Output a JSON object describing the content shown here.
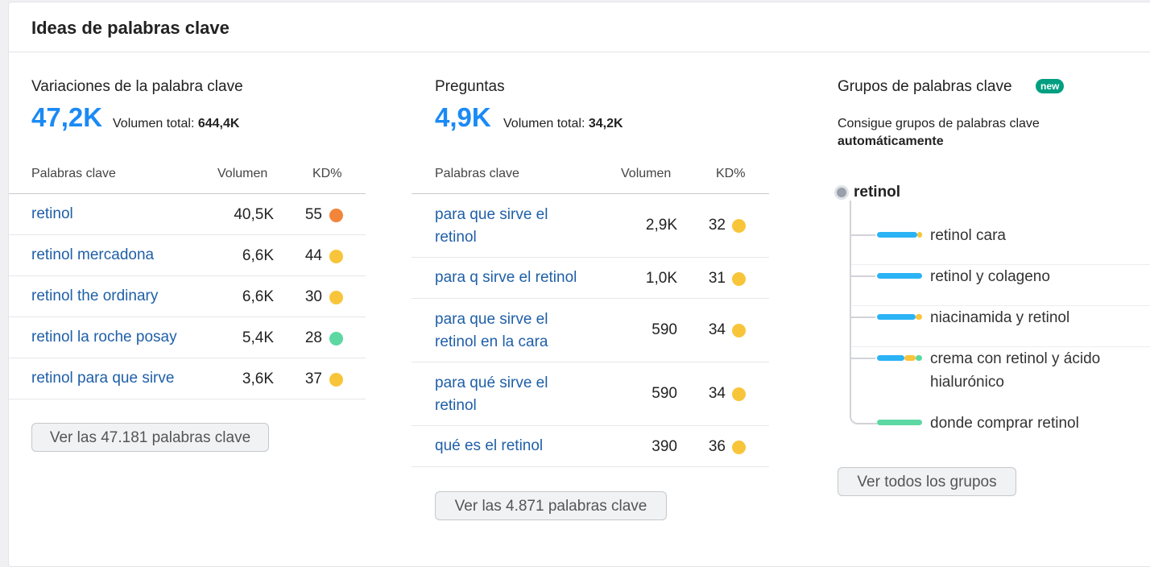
{
  "title": "Ideas de palabras clave",
  "variations": {
    "title": "Variaciones de la palabra clave",
    "count": "47,2K",
    "total_label": "Volumen total:",
    "total_value": "644,4K",
    "headers": {
      "keyword": "Palabras clave",
      "volume": "Volumen",
      "kd": "KD%"
    },
    "rows": [
      {
        "keyword": "retinol",
        "volume": "40,5K",
        "kd": "55",
        "kd_color": "#f2853a"
      },
      {
        "keyword": "retinol mercadona",
        "volume": "6,6K",
        "kd": "44",
        "kd_color": "#f8c53a"
      },
      {
        "keyword": "retinol the ordinary",
        "volume": "6,6K",
        "kd": "30",
        "kd_color": "#f8c53a"
      },
      {
        "keyword": "retinol la roche posay",
        "volume": "5,4K",
        "kd": "28",
        "kd_color": "#5dd8a2"
      },
      {
        "keyword": "retinol para que sirve",
        "volume": "3,6K",
        "kd": "37",
        "kd_color": "#f8c53a"
      }
    ],
    "button": "Ver las 47.181 palabras clave"
  },
  "questions": {
    "title": "Preguntas",
    "count": "4,9K",
    "total_label": "Volumen total:",
    "total_value": "34,2K",
    "headers": {
      "keyword": "Palabras clave",
      "volume": "Volumen",
      "kd": "KD%"
    },
    "rows": [
      {
        "line1": "para que sirve el",
        "line2": "retinol",
        "volume": "2,9K",
        "kd": "32",
        "kd_color": "#f8c53a"
      },
      {
        "line1": "para q sirve el retinol",
        "line2": "",
        "volume": "1,0K",
        "kd": "31",
        "kd_color": "#f8c53a"
      },
      {
        "line1": "para que sirve el",
        "line2": "retinol en la cara",
        "volume": "590",
        "kd": "34",
        "kd_color": "#f8c53a"
      },
      {
        "line1": "para qué sirve el",
        "line2": "retinol",
        "volume": "590",
        "kd": "34",
        "kd_color": "#f8c53a"
      },
      {
        "line1": "qué es el retinol",
        "line2": "",
        "volume": "390",
        "kd": "36",
        "kd_color": "#f8c53a"
      }
    ],
    "button": "Ver las 4.871 palabras clave"
  },
  "groups": {
    "title": "Grupos de palabras clave",
    "badge": "new",
    "desc_line1": "Consigue grupos de palabras clave",
    "desc_line2": "automáticamente",
    "root": "retinol",
    "items": [
      {
        "line1": "retinol cara",
        "line2": ""
      },
      {
        "line1": "retinol y colageno",
        "line2": ""
      },
      {
        "line1": "niacinamida y retinol",
        "line2": ""
      },
      {
        "line1": "crema con retinol y ácido",
        "line2": "hialurónico"
      },
      {
        "line1": "donde comprar retinol",
        "line2": ""
      }
    ],
    "button": "Ver todos los grupos"
  }
}
